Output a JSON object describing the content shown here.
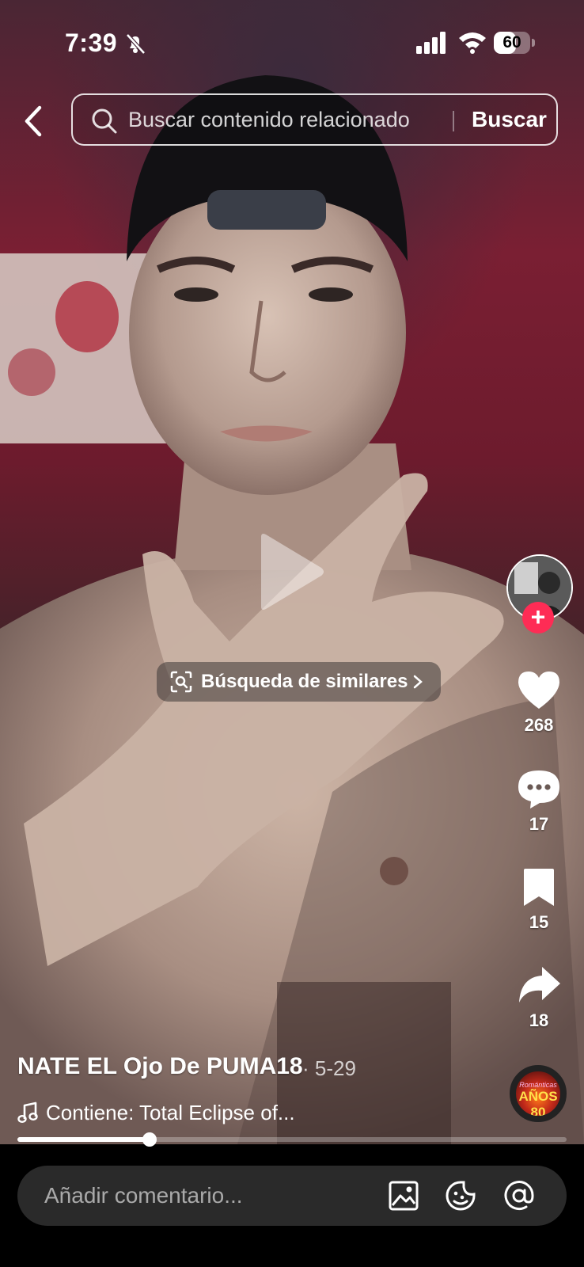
{
  "status_bar": {
    "time": "7:39",
    "battery": "60",
    "battery_level_percent": 60,
    "icons": [
      "bell-slash-icon",
      "signal-icon",
      "wifi-icon",
      "battery-icon"
    ]
  },
  "search": {
    "placeholder": "Buscar contenido relacionado",
    "button_label": "Buscar"
  },
  "player": {
    "similar_search_label": "Búsqueda de similares",
    "progress_fraction": 0.24
  },
  "actions": {
    "likes": "268",
    "comments": "17",
    "saves": "15",
    "shares": "18",
    "follow_symbol": "+"
  },
  "music_disc": {
    "subtitle": "Románticas",
    "title": "AÑOS 80"
  },
  "caption": {
    "author": "NATE EL Ojo De PUMA18",
    "date": "· 5-29",
    "music": "Contiene: Total Eclipse of..."
  },
  "comment_bar": {
    "placeholder": "Añadir comentario..."
  },
  "colors": {
    "accent": "#fe2c55",
    "comment_bar_bg": "#2a2a2a"
  }
}
